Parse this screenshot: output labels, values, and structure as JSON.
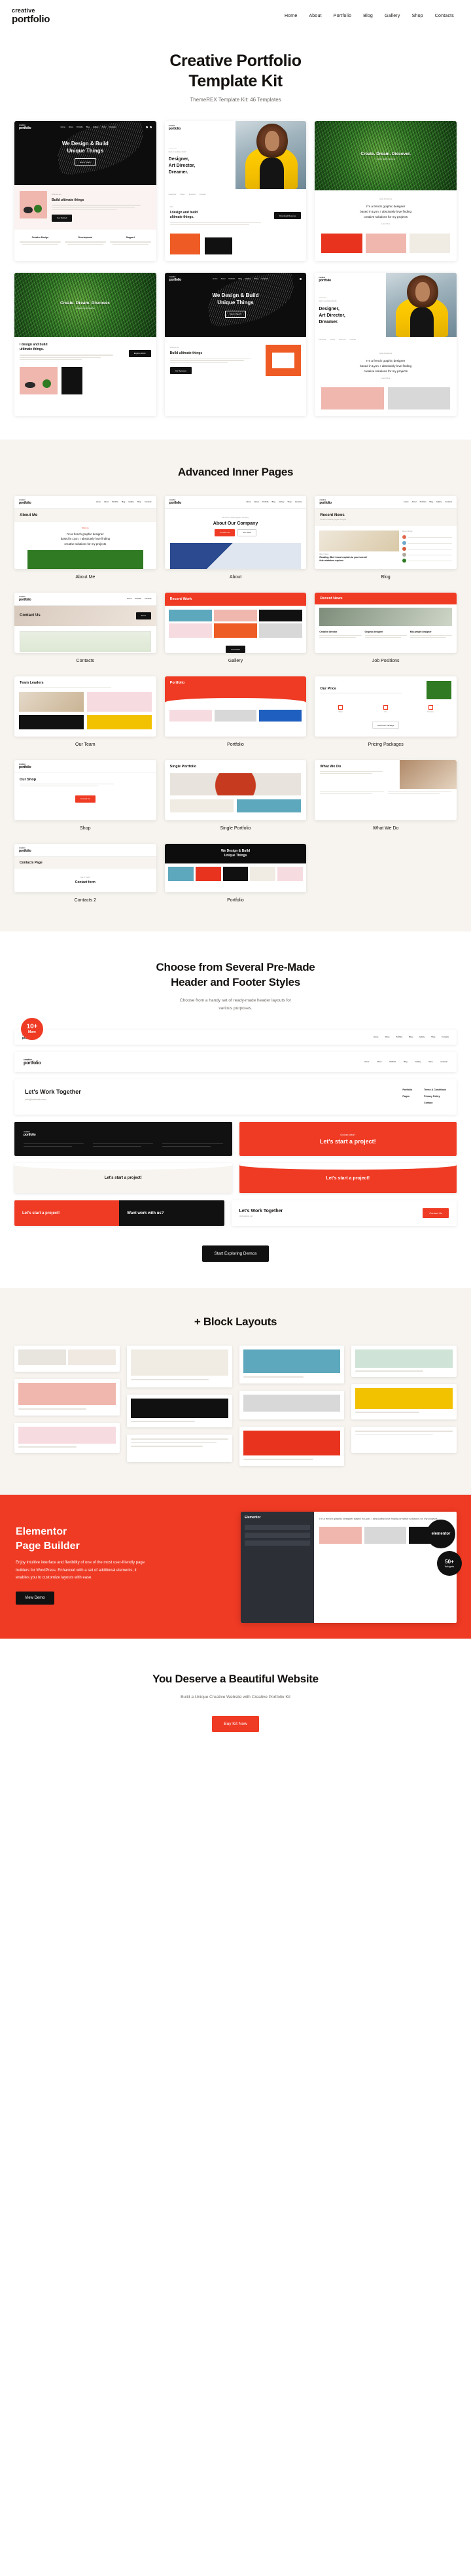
{
  "header": {
    "logo_line1": "creative",
    "logo_line2": "portfolio",
    "nav": [
      {
        "label": "Home"
      },
      {
        "label": "About"
      },
      {
        "label": "Portfolio"
      },
      {
        "label": "Blog"
      },
      {
        "label": "Gallery"
      },
      {
        "label": "Shop"
      },
      {
        "label": "Contacts"
      }
    ]
  },
  "hero": {
    "title_line1": "Creative Portfolio",
    "title_line2": "Template Kit",
    "subtitle": "ThemeREX Template Kit: 46 Templates"
  },
  "home_templates": {
    "row1": [
      {
        "kind": "dark-hero",
        "headline_line1": "We Design & Build",
        "headline_line2": "Unique Things",
        "button": "Get in Touch",
        "section_label": "What we are",
        "section_title": "Build ultimate things",
        "section_btn": "Get Started"
      },
      {
        "kind": "split-designer",
        "eyebrow": "Hello, I am Elena Smith",
        "headline_line1": "Designer,",
        "headline_line2": "Art Director,",
        "headline_line3": "Dreamer.",
        "socials": [
          "Facebook",
          "Twitter",
          "Behance",
          "Dribbble"
        ],
        "section_label": "Intro",
        "section_title_line1": "I design and build",
        "section_title_line2": "ultimate things.",
        "section_btn": "Download Resume"
      },
      {
        "kind": "leaves-hero",
        "headline": "Create. Dream. Discover.",
        "sub": "creative graphic designer",
        "about_line1": "I'm a french graphic designer",
        "about_line2": "based in Lyon. I absolutely love finding",
        "about_line3": "creative solutions for my projects",
        "about_btn": "Learn More"
      }
    ],
    "row2": [
      {
        "kind": "leaves-hero",
        "headline": "Create. Dream. Discover.",
        "sub": "creative graphic designer",
        "section_title_line1": "I design and build",
        "section_title_line2": "ultimate things.",
        "section_btn": "Explore Work"
      },
      {
        "kind": "dark-hero",
        "headline_line1": "We Design & Build",
        "headline_line2": "Unique Things",
        "button": "Get in Touch",
        "section_label": "What we do",
        "section_title": "Build ultimate things",
        "section_btn": "Our Services"
      },
      {
        "kind": "split-designer",
        "eyebrow": "Hello, I am Elena Smith",
        "headline_line1": "Designer,",
        "headline_line2": "Art Director,",
        "headline_line3": "Dreamer.",
        "socials": [
          "Facebook",
          "Twitter",
          "Behance",
          "Dribbble"
        ],
        "about_line1": "I'm a french graphic designer",
        "about_line2": "based in Lyon. I absolutely love finding",
        "about_line3": "creative solutions for my projects",
        "about_btn": "Learn More"
      }
    ]
  },
  "inner_pages": {
    "title": "Advanced Inner Pages",
    "cards": [
      {
        "caption": "About Me",
        "page_title": "About Me",
        "body_line1": "I'm a french graphic designer",
        "body_line2": "based in Lyon. I absolutely love finding",
        "body_line3": "creative solutions for my projects",
        "eyebrow": "Welcome"
      },
      {
        "caption": "About",
        "page_title": "About Our Company",
        "eyebrow": "We are a creative graphic company",
        "btn1": "Contact Us",
        "btn2": "Our Work"
      },
      {
        "caption": "Blog",
        "page_title": "Recent News",
        "eyebrow": "We are a creative graphic designer",
        "sidebar_title": "Recent Posts",
        "post_title_line1": "Reading: But I must explain to you how all",
        "post_title_line2": "this mistaken explore"
      },
      {
        "caption": "Contacts",
        "page_title": "Contact Us",
        "btn": "Send"
      },
      {
        "caption": "Gallery",
        "page_title": "Recent Work",
        "btn": "Load More"
      },
      {
        "caption": "Job Positions",
        "page_title": "Recent News",
        "jobs": [
          "Creative director",
          "Graphic designer",
          "Mid-weight designer"
        ]
      },
      {
        "caption": "Our Team",
        "page_title": "Team Leaders"
      },
      {
        "caption": "Portfolio",
        "page_title": "Portfolio"
      },
      {
        "caption": "Pricing Packages",
        "page_title": "Our Price",
        "btn": "See Price Package"
      },
      {
        "caption": "Shop",
        "page_title": "Our Shop",
        "btn": "Contact Us"
      },
      {
        "caption": "Single Portfolio",
        "page_title": "Single Portfolio"
      },
      {
        "caption": "What We Do",
        "page_title": "What We Do"
      },
      {
        "caption": "Contacts 2",
        "page_title": "Contacts Page",
        "form_label": "Get in Touch",
        "form_title": "Contact form"
      },
      {
        "caption": "Portfolio",
        "page_title_line1": "We Design & Build",
        "page_title_line2": "Unique Things"
      }
    ]
  },
  "header_footer": {
    "title_line1": "Choose from Several Pre-Made",
    "title_line2": "Header and Footer Styles",
    "subtitle_line1": "Choose from a handy set of ready-made header layouts for",
    "subtitle_line2": "various purposes.",
    "badge_number": "10+",
    "badge_label": "More",
    "variants": [
      {
        "type": "header-plain",
        "logo1": "creative",
        "logo2": "portfolio",
        "nav": [
          "Home",
          "About",
          "Portfolio",
          "Blog",
          "Gallery",
          "Shop",
          "Contacts"
        ]
      },
      {
        "type": "header-boxed",
        "logo1": "creative",
        "logo2": "portfolio",
        "nav": [
          "Home",
          "About",
          "Portfolio",
          "Blog",
          "Gallery",
          "Shop",
          "Contacts"
        ]
      },
      {
        "type": "footer-light",
        "title": "Let's Work Together",
        "email": "info@website.com",
        "col1_title": "Portfolio",
        "col2_title": "Pages",
        "col3_title": "Terms & Conditions",
        "col4_title": "Privacy Policy",
        "col5_title": "Contact"
      },
      {
        "type": "footer-dark",
        "logo1": "creative",
        "logo2": "portfolio"
      },
      {
        "type": "footer-red",
        "title_small": "Got an idea?",
        "title": "Let's start a project!"
      },
      {
        "type": "footer-wave-cream",
        "title": "Let's start a project!"
      },
      {
        "type": "footer-wave-red",
        "title": "Let's start a project!"
      },
      {
        "type": "footer-split-red",
        "title": "Let's start a project!"
      },
      {
        "type": "footer-split-dark",
        "title": "Want work with us?"
      },
      {
        "type": "footer-contact",
        "title": "Let's Work Together",
        "email": "info@website.com",
        "btn": "Contact Us"
      }
    ],
    "cta_button": "Start Exploring Demos"
  },
  "block_layouts": {
    "title": "+ Block Layouts"
  },
  "elementor": {
    "title_line1": "Elementor",
    "title_line2": "Page Builder",
    "body": "Enjoy intuitive interface and flexibility of one of the most user-friendly page builders for WordPress. Enhanced with a set of additional elements, it enables you to customize layouts with ease.",
    "button": "View Demo",
    "badge_text": "elementor",
    "badge2_number": "50+",
    "badge2_label": "Widgets"
  },
  "final_cta": {
    "title": "You Deserve a Beautiful Website",
    "subtitle": "Build a Unique Creative Website with Creative Portfolio Kit",
    "button": "Buy Kit Now"
  },
  "colors": {
    "accent_red": "#EF3A24",
    "orange": "#F58220",
    "dark": "#111111",
    "cream": "#F7F4EF"
  }
}
